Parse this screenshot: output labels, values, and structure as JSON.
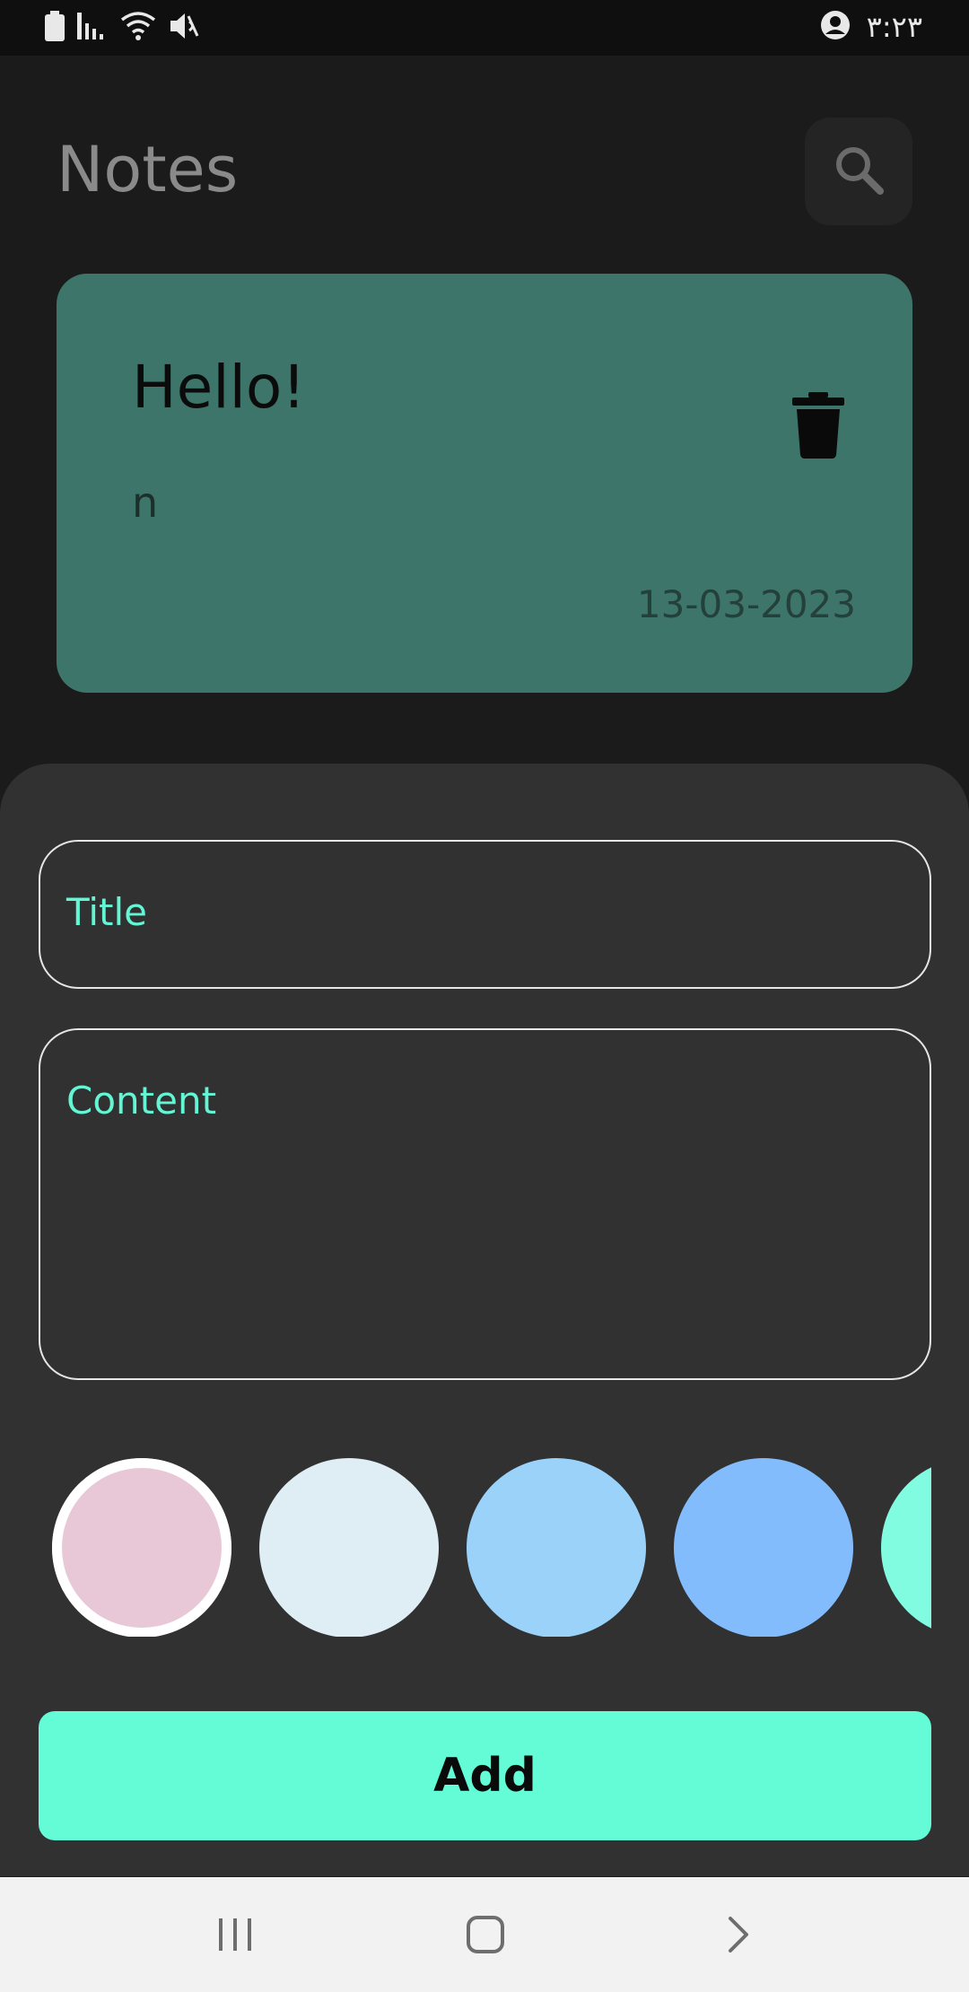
{
  "status_bar": {
    "time": "٣:٢٣",
    "icons": [
      "battery-icon",
      "signal-icon",
      "wifi-icon",
      "mute-icon",
      "account-icon"
    ]
  },
  "header": {
    "title": "Notes",
    "search_icon": "search-icon"
  },
  "notes": [
    {
      "title": "Hello!",
      "content": "n",
      "date": "13-03-2023",
      "color": "#3d756b",
      "delete_icon": "trash-icon"
    }
  ],
  "add_sheet": {
    "title_label": "Title",
    "content_label": "Content",
    "colors": [
      "#e8c8d6",
      "#dfedf5",
      "#9ad2fa",
      "#82bcfc",
      "#82fce0"
    ],
    "selected_color_index": 0,
    "add_button_label": "Add",
    "accent": "#63fcd6"
  },
  "nav_bar": {
    "buttons": [
      "recents-icon",
      "home-icon",
      "back-icon"
    ]
  }
}
